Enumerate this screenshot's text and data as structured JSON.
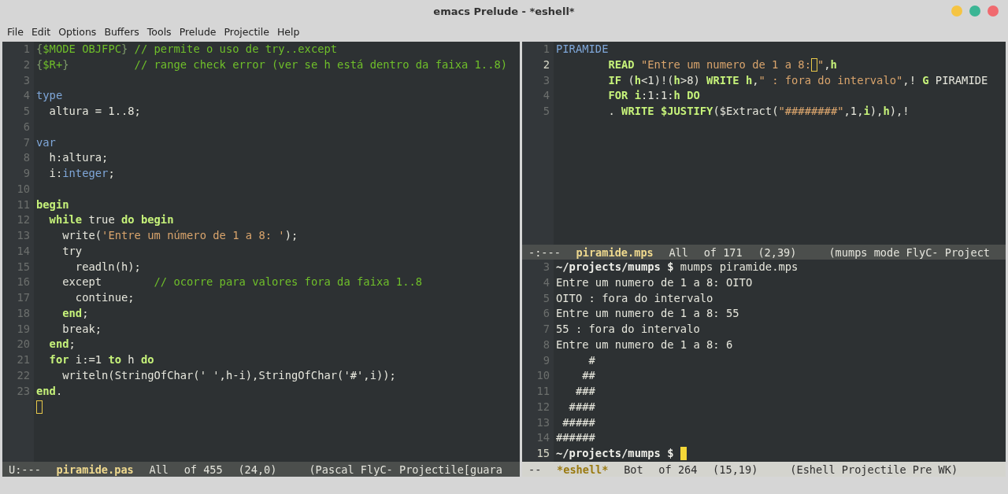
{
  "window": {
    "title": "emacs Prelude - *eshell*",
    "controls": [
      {
        "color": "#f5c443"
      },
      {
        "color": "#3bb594"
      },
      {
        "color": "#f06a6f"
      }
    ]
  },
  "menu": [
    {
      "label": "File"
    },
    {
      "label": "Edit"
    },
    {
      "label": "Options"
    },
    {
      "label": "Buffers"
    },
    {
      "label": "Tools"
    },
    {
      "label": "Prelude"
    },
    {
      "label": "Projectile"
    },
    {
      "label": "Help"
    }
  ],
  "left": {
    "lines": [
      {
        "number": "1",
        "current": false,
        "tokens": [
          {
            "kind": "brace",
            "text": "{"
          },
          {
            "kind": "comment",
            "text": "$MODE OBJFPC"
          },
          {
            "kind": "brace",
            "text": "}"
          },
          {
            "kind": "comment",
            "text": " // permite o uso de try..except"
          }
        ]
      },
      {
        "number": "2",
        "current": false,
        "tokens": [
          {
            "kind": "brace",
            "text": "{"
          },
          {
            "kind": "comment",
            "text": "$R+"
          },
          {
            "kind": "brace",
            "text": "}"
          },
          {
            "kind": "comment",
            "text": "          // range check error (ver se h está dentro da faixa 1..8)"
          }
        ]
      },
      {
        "number": "3",
        "current": false
      },
      {
        "number": "4",
        "current": false,
        "tokens": [
          {
            "kind": "type",
            "text": "type"
          }
        ]
      },
      {
        "number": "5",
        "current": false,
        "tokens": [
          {
            "kind": "plain",
            "text": "  altura = 1..8;"
          }
        ]
      },
      {
        "number": "6",
        "current": false
      },
      {
        "number": "7",
        "current": false,
        "tokens": [
          {
            "kind": "type",
            "text": "var"
          }
        ]
      },
      {
        "number": "8",
        "current": false,
        "tokens": [
          {
            "kind": "plain",
            "text": "  h:altura;"
          }
        ]
      },
      {
        "number": "9",
        "current": false,
        "tokens": [
          {
            "kind": "plain",
            "text": "  i:"
          },
          {
            "kind": "type",
            "text": "integer"
          },
          {
            "kind": "plain",
            "text": ";"
          }
        ]
      },
      {
        "number": "10",
        "current": false
      },
      {
        "number": "11",
        "current": false,
        "tokens": [
          {
            "kind": "keyword",
            "text": "begin"
          }
        ]
      },
      {
        "number": "12",
        "current": false,
        "tokens": [
          {
            "kind": "keyword",
            "text": "  while"
          },
          {
            "kind": "plain",
            "text": " true "
          },
          {
            "kind": "keyword",
            "text": "do begin"
          }
        ]
      },
      {
        "number": "13",
        "current": false,
        "tokens": [
          {
            "kind": "plain",
            "text": "    write("
          },
          {
            "kind": "string",
            "text": "'Entre um número de 1 a 8: '"
          },
          {
            "kind": "plain",
            "text": ");"
          }
        ]
      },
      {
        "number": "14",
        "current": false,
        "tokens": [
          {
            "kind": "plain",
            "text": "    try"
          }
        ]
      },
      {
        "number": "15",
        "current": false,
        "tokens": [
          {
            "kind": "plain",
            "text": "      readln(h);"
          }
        ]
      },
      {
        "number": "16",
        "current": false,
        "tokens": [
          {
            "kind": "plain",
            "text": "    except        "
          },
          {
            "kind": "comment",
            "text": "// ocorre para valores fora da faixa 1..8"
          }
        ]
      },
      {
        "number": "17",
        "current": false,
        "tokens": [
          {
            "kind": "plain",
            "text": "      continue;"
          }
        ]
      },
      {
        "number": "18",
        "current": false,
        "tokens": [
          {
            "kind": "keyword",
            "text": "    end"
          },
          {
            "kind": "plain",
            "text": ";"
          }
        ]
      },
      {
        "number": "19",
        "current": false,
        "tokens": [
          {
            "kind": "plain",
            "text": "    break;"
          }
        ]
      },
      {
        "number": "20",
        "current": false,
        "tokens": [
          {
            "kind": "keyword",
            "text": "  end"
          },
          {
            "kind": "plain",
            "text": ";"
          }
        ]
      },
      {
        "number": "21",
        "current": false,
        "tokens": [
          {
            "kind": "keyword",
            "text": "  for"
          },
          {
            "kind": "plain",
            "text": " i:=1 "
          },
          {
            "kind": "keyword",
            "text": "to"
          },
          {
            "kind": "plain",
            "text": " h "
          },
          {
            "kind": "keyword",
            "text": "do"
          }
        ]
      },
      {
        "number": "22",
        "current": false,
        "tokens": [
          {
            "kind": "plain",
            "text": "    writeln(StringOfChar(' ',h-i),StringOfChar('#',i));"
          }
        ]
      },
      {
        "number": "23",
        "current": false,
        "tokens": [
          {
            "kind": "keyword",
            "text": "end"
          },
          {
            "kind": "plain",
            "text": "."
          }
        ]
      },
      {
        "tokens": [
          {
            "kind": "cursor-hollow"
          }
        ]
      }
    ],
    "modeline": {
      "active": false,
      "segments": [
        {
          "kind": "status",
          "text": "U:---"
        },
        {
          "kind": "buffer",
          "text": "piramide.pas"
        },
        {
          "kind": "plain",
          "text": "All"
        },
        {
          "kind": "plain",
          "text": "of 455"
        },
        {
          "kind": "plain",
          "text": "(24,0)"
        },
        {
          "kind": "modes",
          "text": "(Pascal FlyC- Projectile[guara"
        }
      ]
    }
  },
  "top_right": {
    "lines": [
      {
        "number": "1",
        "current": false,
        "tokens": [
          {
            "kind": "type",
            "text": "PIRAMIDE"
          }
        ]
      },
      {
        "number": "2",
        "current": true,
        "tokens": [
          {
            "kind": "keyword",
            "text": "        READ"
          },
          {
            "kind": "string",
            "text": " \"Entre um numero de 1 a 8:"
          },
          {
            "kind": "cursor-hollow"
          },
          {
            "kind": "string",
            "text": "\""
          },
          {
            "kind": "plain",
            "text": ","
          },
          {
            "kind": "keyword",
            "text": "h"
          }
        ]
      },
      {
        "number": "3",
        "current": false,
        "tokens": [
          {
            "kind": "keyword",
            "text": "        IF"
          },
          {
            "kind": "plain",
            "text": " ("
          },
          {
            "kind": "keyword",
            "text": "h"
          },
          {
            "kind": "plain",
            "text": "<1)!("
          },
          {
            "kind": "keyword",
            "text": "h"
          },
          {
            "kind": "plain",
            "text": ">8) "
          },
          {
            "kind": "keyword",
            "text": "WRITE h"
          },
          {
            "kind": "plain",
            "text": ","
          },
          {
            "kind": "string",
            "text": "\" : fora do intervalo\""
          },
          {
            "kind": "plain",
            "text": ",! "
          },
          {
            "kind": "keyword",
            "text": "G"
          },
          {
            "kind": "plain",
            "text": " PIRAMIDE"
          }
        ]
      },
      {
        "number": "4",
        "current": false,
        "tokens": [
          {
            "kind": "keyword",
            "text": "        FOR i"
          },
          {
            "kind": "plain",
            "text": ":1:1:"
          },
          {
            "kind": "keyword",
            "text": "h DO"
          }
        ]
      },
      {
        "number": "5",
        "current": false,
        "tokens": [
          {
            "kind": "plain",
            "text": "        . "
          },
          {
            "kind": "keyword",
            "text": "WRITE $JUSTIFY"
          },
          {
            "kind": "plain",
            "text": "($Extract("
          },
          {
            "kind": "string",
            "text": "\"########\""
          },
          {
            "kind": "plain",
            "text": ",1,"
          },
          {
            "kind": "keyword",
            "text": "i"
          },
          {
            "kind": "plain",
            "text": "),"
          },
          {
            "kind": "keyword",
            "text": "h"
          },
          {
            "kind": "plain",
            "text": "),!"
          }
        ]
      }
    ],
    "modeline": {
      "active": false,
      "segments": [
        {
          "kind": "status",
          "text": "-:---"
        },
        {
          "kind": "buffer",
          "text": "piramide.mps"
        },
        {
          "kind": "plain",
          "text": "All"
        },
        {
          "kind": "plain",
          "text": "of 171"
        },
        {
          "kind": "plain",
          "text": "(2,39)"
        },
        {
          "kind": "modes",
          "text": "(mumps mode FlyC- Project"
        }
      ]
    }
  },
  "bottom_right": {
    "lines": [
      {
        "number": "3",
        "current": false,
        "tokens": [
          {
            "kind": "prompt",
            "text": "~/projects/mumps $"
          },
          {
            "kind": "plain",
            "text": " mumps piramide.mps"
          }
        ]
      },
      {
        "number": "4",
        "current": false,
        "tokens": [
          {
            "kind": "plain",
            "text": "Entre um numero de 1 a 8: OITO"
          }
        ]
      },
      {
        "number": "5",
        "current": false,
        "tokens": [
          {
            "kind": "plain",
            "text": "OITO : fora do intervalo"
          }
        ]
      },
      {
        "number": "6",
        "current": false,
        "tokens": [
          {
            "kind": "plain",
            "text": "Entre um numero de 1 a 8: 55"
          }
        ]
      },
      {
        "number": "7",
        "current": false,
        "tokens": [
          {
            "kind": "plain",
            "text": "55 : fora do intervalo"
          }
        ]
      },
      {
        "number": "8",
        "current": false,
        "tokens": [
          {
            "kind": "plain",
            "text": "Entre um numero de 1 a 8: 6"
          }
        ]
      },
      {
        "number": "9",
        "current": false,
        "tokens": [
          {
            "kind": "plain",
            "text": "     #"
          }
        ]
      },
      {
        "number": "10",
        "current": false,
        "tokens": [
          {
            "kind": "plain",
            "text": "    ##"
          }
        ]
      },
      {
        "number": "11",
        "current": false,
        "tokens": [
          {
            "kind": "plain",
            "text": "   ###"
          }
        ]
      },
      {
        "number": "12",
        "current": false,
        "tokens": [
          {
            "kind": "plain",
            "text": "  ####"
          }
        ]
      },
      {
        "number": "13",
        "current": false,
        "tokens": [
          {
            "kind": "plain",
            "text": " #####"
          }
        ]
      },
      {
        "number": "14",
        "current": false,
        "tokens": [
          {
            "kind": "plain",
            "text": "######"
          }
        ]
      },
      {
        "number": "15",
        "current": true,
        "tokens": [
          {
            "kind": "prompt",
            "text": "~/projects/mumps $ "
          },
          {
            "kind": "cursor-filled"
          }
        ]
      }
    ],
    "modeline": {
      "active": true,
      "segments": [
        {
          "kind": "status",
          "text": "--"
        },
        {
          "kind": "buffer",
          "text": "*eshell*"
        },
        {
          "kind": "plain",
          "text": "Bot"
        },
        {
          "kind": "plain",
          "text": "of 264"
        },
        {
          "kind": "plain",
          "text": "(15,19)"
        },
        {
          "kind": "modes",
          "text": "(Eshell Projectile Pre WK)"
        }
      ]
    }
  }
}
